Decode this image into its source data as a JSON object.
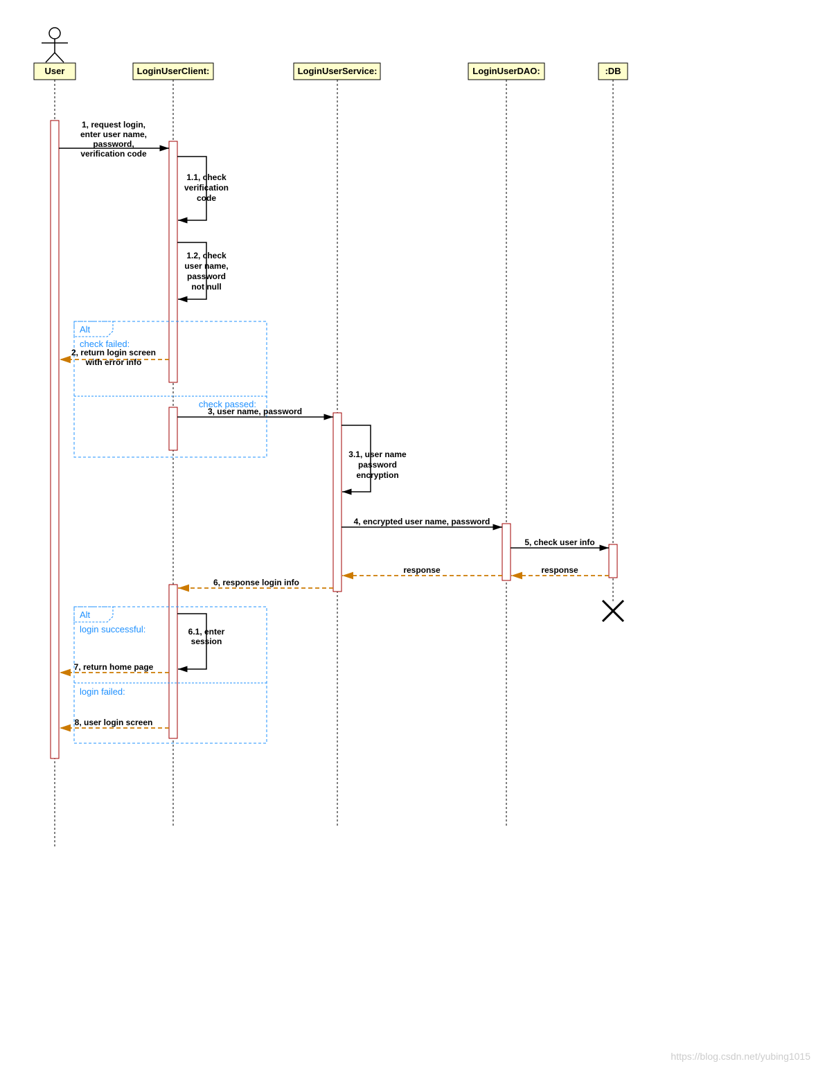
{
  "watermark": "https://blog.csdn.net/yubing1015",
  "participants": {
    "user": "User",
    "client": "LoginUserClient:",
    "service": "LoginUserService:",
    "dao": "LoginUserDAO:",
    "db": ":DB"
  },
  "messages": {
    "m1_l1": "1, request login,",
    "m1_l2": "enter user name,",
    "m1_l3": "password,",
    "m1_l4": "verification code",
    "m11_l1": "1.1, check",
    "m11_l2": "verification",
    "m11_l3": "code",
    "m12_l1": "1.2, check",
    "m12_l2": "user name,",
    "m12_l3": "password",
    "m12_l4": "not null",
    "m2_l1": "2, return login screen",
    "m2_l2": "with error info",
    "m3": "3, user name, password",
    "m31_l1": "3.1, user name",
    "m31_l2": "password",
    "m31_l3": "encryption",
    "m4": "4, encrypted user name, password",
    "m5": "5, check user info",
    "resp1": "response",
    "resp2": "response",
    "m6": "6, response login info",
    "m61_l1": "6.1, enter",
    "m61_l2": "session",
    "m7": "7, return home page",
    "m8": "8, user login screen"
  },
  "fragments": {
    "alt1": "Alt",
    "cond1a": "check failed:",
    "cond1b": "check passed:",
    "alt2": "Alt",
    "cond2a": "login successful:",
    "cond2b": "login failed:"
  }
}
